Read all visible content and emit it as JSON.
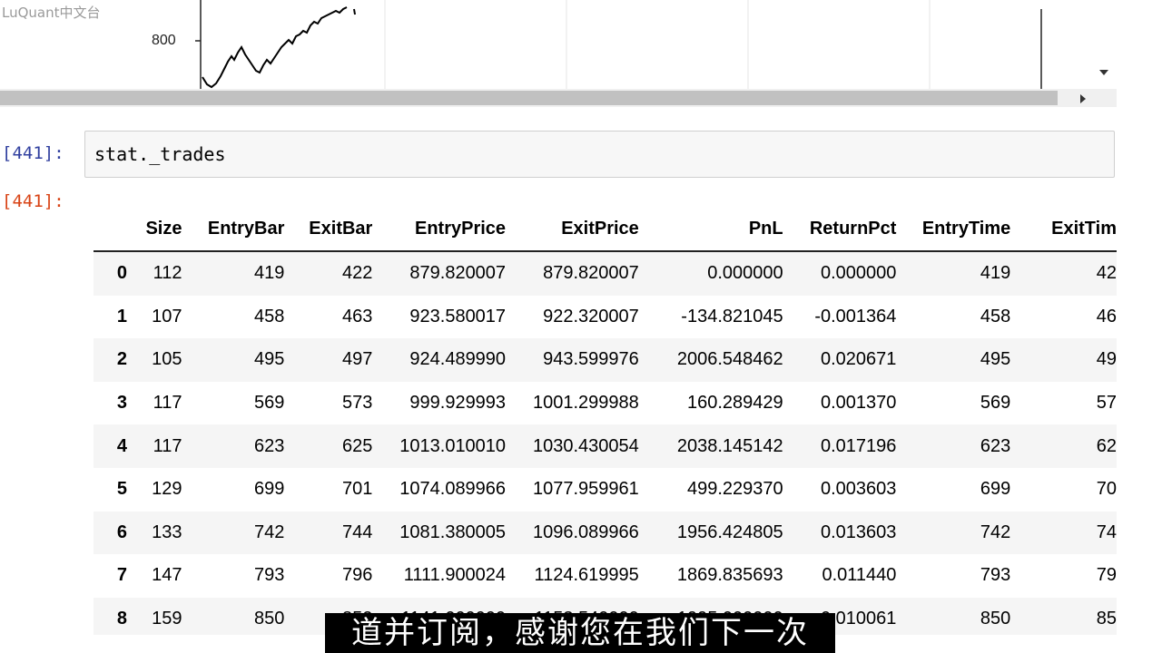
{
  "watermark": "LuQuant中文台",
  "chart": {
    "ytick_label": "800"
  },
  "input_cell": {
    "prompt": "[441]:",
    "code": "stat._trades"
  },
  "output_cell": {
    "prompt": "[441]:"
  },
  "dataframe": {
    "columns": [
      "",
      "Size",
      "EntryBar",
      "ExitBar",
      "EntryPrice",
      "ExitPrice",
      "PnL",
      "ReturnPct",
      "EntryTime",
      "ExitTim"
    ],
    "rows": [
      [
        "0",
        "112",
        "419",
        "422",
        "879.820007",
        "879.820007",
        "0.000000",
        "0.000000",
        "419",
        "42"
      ],
      [
        "1",
        "107",
        "458",
        "463",
        "923.580017",
        "922.320007",
        "-134.821045",
        "-0.001364",
        "458",
        "46"
      ],
      [
        "2",
        "105",
        "495",
        "497",
        "924.489990",
        "943.599976",
        "2006.548462",
        "0.020671",
        "495",
        "49"
      ],
      [
        "3",
        "117",
        "569",
        "573",
        "999.929993",
        "1001.299988",
        "160.289429",
        "0.001370",
        "569",
        "57"
      ],
      [
        "4",
        "117",
        "623",
        "625",
        "1013.010010",
        "1030.430054",
        "2038.145142",
        "0.017196",
        "623",
        "62"
      ],
      [
        "5",
        "129",
        "699",
        "701",
        "1074.089966",
        "1077.959961",
        "499.229370",
        "0.003603",
        "699",
        "70"
      ],
      [
        "6",
        "133",
        "742",
        "744",
        "1081.380005",
        "1096.089966",
        "1956.424805",
        "0.013603",
        "742",
        "74"
      ],
      [
        "7",
        "147",
        "793",
        "796",
        "1111.900024",
        "1124.619995",
        "1869.835693",
        "0.011440",
        "793",
        "79"
      ],
      [
        "8",
        "159",
        "850",
        "852",
        "1141.000000",
        "1153.540000",
        "1995.000000",
        "0.010061",
        "850",
        "85"
      ]
    ]
  },
  "subtitle": "道并订阅，感谢您在我们下一次"
}
